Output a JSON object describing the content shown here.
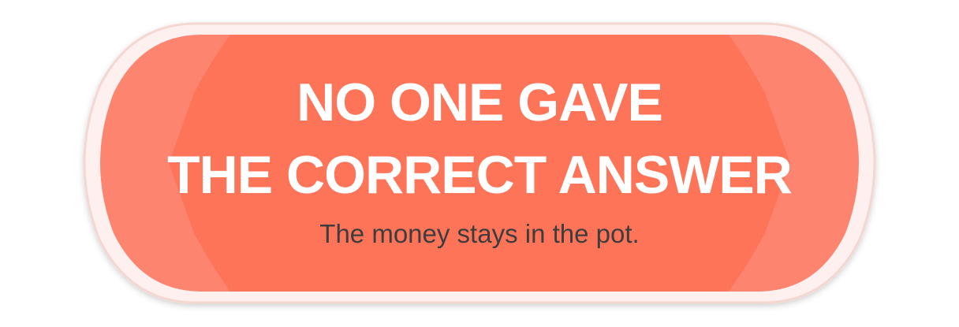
{
  "banner": {
    "headline_line1": "NO ONE GAVE",
    "headline_line2": "THE CORRECT ANSWER",
    "subtext": "The money stays in the pot.",
    "colors": {
      "outer_frame": "#fdf0ee",
      "outer_frame_border": "#f5d7d2",
      "panel_side": "#fd8570",
      "panel_center": "#fe7459",
      "headline_text": "#ffffff",
      "subtext": "#3d3d3d"
    }
  }
}
